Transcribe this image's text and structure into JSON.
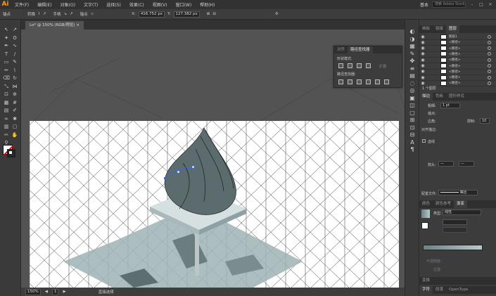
{
  "app": {
    "logo": "Ai"
  },
  "menu": [
    "文件(F)",
    "编辑(E)",
    "对象(O)",
    "文字(T)",
    "选择(S)",
    "效果(C)",
    "视图(V)",
    "窗口(W)",
    "帮助(H)"
  ],
  "menu_right": {
    "workspace": "基本",
    "search_placeholder": "搜索 Adobe Stock"
  },
  "control": {
    "selection": "锚点",
    "convert": "转换",
    "handles": "手柄",
    "anchors": "锚点",
    "x_value": "416.752",
    "y_value": "127.382",
    "unit": "px"
  },
  "doc_tab": "Lo* @ 150% (RGB/预览)",
  "status": {
    "zoom": "150%",
    "artboard": "1",
    "tool_name": "直接选择"
  },
  "pathfinder": {
    "tab1": "对齐",
    "tab2": "路径查找器",
    "shape_modes": "形状模式:",
    "pathfinders": "路径查找器:",
    "expand": "扩展"
  },
  "layers": {
    "tabs": [
      "画板",
      "链接",
      "图层"
    ],
    "rows": [
      "图层1",
      "<路径>",
      "<路径>",
      "<路径>",
      "<路径>",
      "<路径>",
      "<路径>",
      "<路径>",
      "<路径>"
    ],
    "footer": "1 个图层"
  },
  "stroke": {
    "tabs": [
      "描边",
      "色板",
      "图形样式"
    ],
    "weight_label": "粗细:",
    "weight_value": "1 pt",
    "cap_label": "端点:",
    "corner_label": "边角:",
    "limit_label": "限制:",
    "limit_value": "10",
    "align_label": "对齐描边:",
    "dashed_label": "虚线",
    "arrow_label": "箭头:",
    "profile_label": "配置文件:",
    "profile_value": "等比"
  },
  "gradient": {
    "tabs": [
      "颜色",
      "颜色参考",
      "渐变"
    ],
    "type_label": "类型:",
    "type_value": "线性",
    "angle_label": "",
    "opacity_label": "不透明度:",
    "position_label": "位置:"
  },
  "bottom": {
    "transform": "变换",
    "tabs": [
      "字符",
      "段落",
      "OpenType"
    ]
  },
  "colors": {
    "accent": "#ff9a00",
    "shape": "#5b6b6e",
    "grid_bg": "#ffffff",
    "selection": "#3a62ff"
  }
}
